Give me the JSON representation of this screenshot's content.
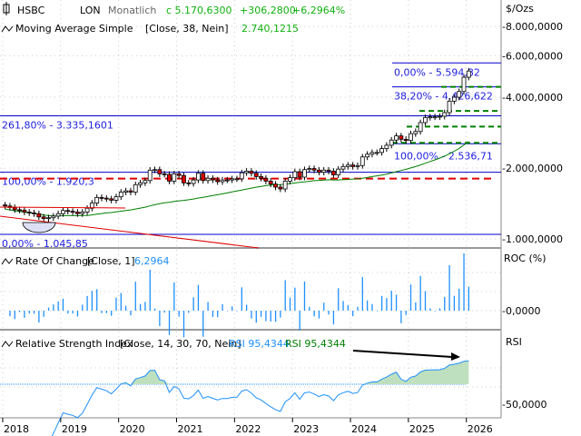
{
  "header": {
    "symbol": "HSBC",
    "exchange": "LON",
    "period": "Monatlich",
    "close": "c 5.170,6300",
    "change": "+306,2800",
    "change_pct": "+6,2964%",
    "unit": "$/Ozs"
  },
  "ma": {
    "label": "Moving Average Simple",
    "params": "[Close, 38, Nein]",
    "value": "2.740,1215",
    "period": 38
  },
  "roc": {
    "label": "Rate Of Change",
    "params": "[Close, 1]",
    "value": "6,2964",
    "axis_label": "ROC (%)",
    "zero_label": "-0,0000"
  },
  "rsi": {
    "label": "Relative Strength Index",
    "params": "[Close, 14, 30, 70, Nein]",
    "value_blue": "RSI 95,4344",
    "value_green": "RSI 95,4344",
    "axis_label": "RSI",
    "tick_label": "-50,0000",
    "period": 14,
    "upper": 70
  },
  "price_axis": {
    "scale": "log",
    "ticks": [
      {
        "value": 8000,
        "label": "-8.000,0000"
      },
      {
        "value": 6000,
        "label": "-6.000,0000"
      },
      {
        "value": 4000,
        "label": "-4.000,0000"
      },
      {
        "value": 2000,
        "label": "-2.000,0000"
      },
      {
        "value": 1000,
        "label": "-1.000,0000"
      }
    ]
  },
  "x_axis": {
    "years": [
      "2018",
      "2019",
      "2020",
      "2021",
      "2022",
      "2023",
      "2024",
      "2025",
      "2026"
    ]
  },
  "fib_levels": [
    {
      "label": "0,00% - 5.594,82",
      "value": 5594.82
    },
    {
      "label": "38,20% - 4.426,622",
      "value": 4426.622
    },
    {
      "label": "100,00% - 2.536,71",
      "value": 2536.71
    },
    {
      "label": "261,80% - 3.335,1601",
      "value": 3335.1601
    },
    {
      "label": "100,00% - 1.920,3",
      "value": 1920.3
    },
    {
      "label": "0,00% - 1.045,85",
      "value": 1045.85
    }
  ],
  "colors": {
    "up": "#ffffff",
    "down": "#e00000",
    "ma": "#008000",
    "roc": "#1e90ff",
    "rsi": "#1e90ff",
    "rsi_fill": "#bfe0bf",
    "fib": "#0000cc",
    "green_text": "#10b010"
  },
  "chart_data": {
    "type": "candlestick",
    "start": "2018-01",
    "interval": "monthly",
    "closes": [
      1380,
      1360,
      1330,
      1325,
      1300,
      1290,
      1280,
      1240,
      1220,
      1230,
      1250,
      1280,
      1320,
      1310,
      1300,
      1280,
      1300,
      1350,
      1420,
      1500,
      1490,
      1480,
      1460,
      1510,
      1580,
      1600,
      1580,
      1700,
      1730,
      1770,
      1960,
      1970,
      1890,
      1880,
      1760,
      1890,
      1860,
      1730,
      1720,
      1780,
      1900,
      1770,
      1810,
      1780,
      1750,
      1780,
      1780,
      1800,
      1800,
      1910,
      1940,
      1900,
      1840,
      1810,
      1760,
      1710,
      1660,
      1630,
      1760,
      1820,
      1930,
      1830,
      1970,
      1990,
      1960,
      1920,
      1960,
      1940,
      1870,
      1980,
      2030,
      2060,
      2030,
      2050,
      2230,
      2290,
      2330,
      2330,
      2420,
      2500,
      2630,
      2740,
      2650,
      2620,
      2800,
      2860,
      3120,
      3280,
      3300,
      3300,
      3320,
      3440,
      3850,
      4000,
      4230,
      4864,
      5170
    ]
  }
}
